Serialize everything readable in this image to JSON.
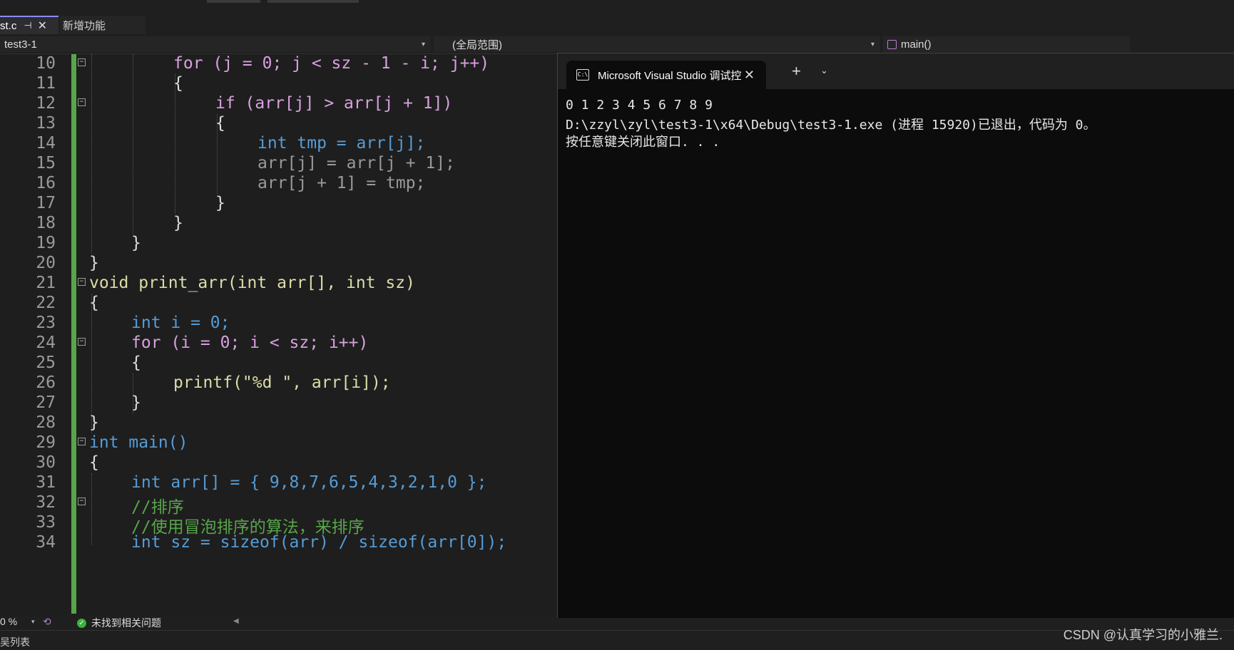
{
  "editor_tab": {
    "title": "st.c",
    "pin": "⊣",
    "close": "✕"
  },
  "new_features_tab": "新增功能",
  "nav": {
    "project": "test3-1",
    "scope": "(全局范围)",
    "function": "main()"
  },
  "code_lines": [
    {
      "n": "10"
    },
    {
      "n": "11"
    },
    {
      "n": "12"
    },
    {
      "n": "13"
    },
    {
      "n": "14"
    },
    {
      "n": "15"
    },
    {
      "n": "16"
    },
    {
      "n": "17"
    },
    {
      "n": "18"
    },
    {
      "n": "19"
    },
    {
      "n": "20"
    },
    {
      "n": "21"
    },
    {
      "n": "22"
    },
    {
      "n": "23"
    },
    {
      "n": "24"
    },
    {
      "n": "25"
    },
    {
      "n": "26"
    },
    {
      "n": "27"
    },
    {
      "n": "28"
    },
    {
      "n": "29"
    },
    {
      "n": "30"
    },
    {
      "n": "31"
    },
    {
      "n": "32"
    },
    {
      "n": "33"
    },
    {
      "n": "34"
    }
  ],
  "code": {
    "l10": "for (j = 0; j < sz - 1 - i; j++)",
    "l11": "{",
    "l12": "if (arr[j] > arr[j + 1])",
    "l13": "{",
    "l14": "int tmp = arr[j];",
    "l15": "arr[j] = arr[j + 1];",
    "l16": "arr[j + 1] = tmp;",
    "l17": "}",
    "l18": "}",
    "l19": "}",
    "l20": "}",
    "l21": "void print_arr(int arr[], int sz)",
    "l22": "{",
    "l23": "int i = 0;",
    "l24": "for (i = 0; i < sz; i++)",
    "l25": "{",
    "l26": "printf(\"%d \", arr[i]);",
    "l27": "}",
    "l28": "}",
    "l29": "int main()",
    "l30": "{",
    "l31": "int arr[] = { 9,8,7,6,5,4,3,2,1,0 };",
    "l32": "//排序",
    "l33": "//使用冒泡排序的算法，来排序",
    "l34": "int sz = sizeof(arr) / sizeof(arr[0]);"
  },
  "console": {
    "tab_title": "Microsoft Visual Studio 调试控",
    "tab_close": "✕",
    "add": "+",
    "chevron": "⌄",
    "output": [
      "0 1 2 3 4 5 6 7 8 9",
      "D:\\zzyl\\zyl\\test3-1\\x64\\Debug\\test3-1.exe (进程 15920)已退出，代码为 0。",
      "按任意键关闭此窗口. . ."
    ]
  },
  "status": {
    "zoom": "0 %",
    "issues": "未找到相关问题"
  },
  "bottom": {
    "error_list": "吴列表"
  },
  "watermark": "CSDN @认真学习的小雅兰."
}
